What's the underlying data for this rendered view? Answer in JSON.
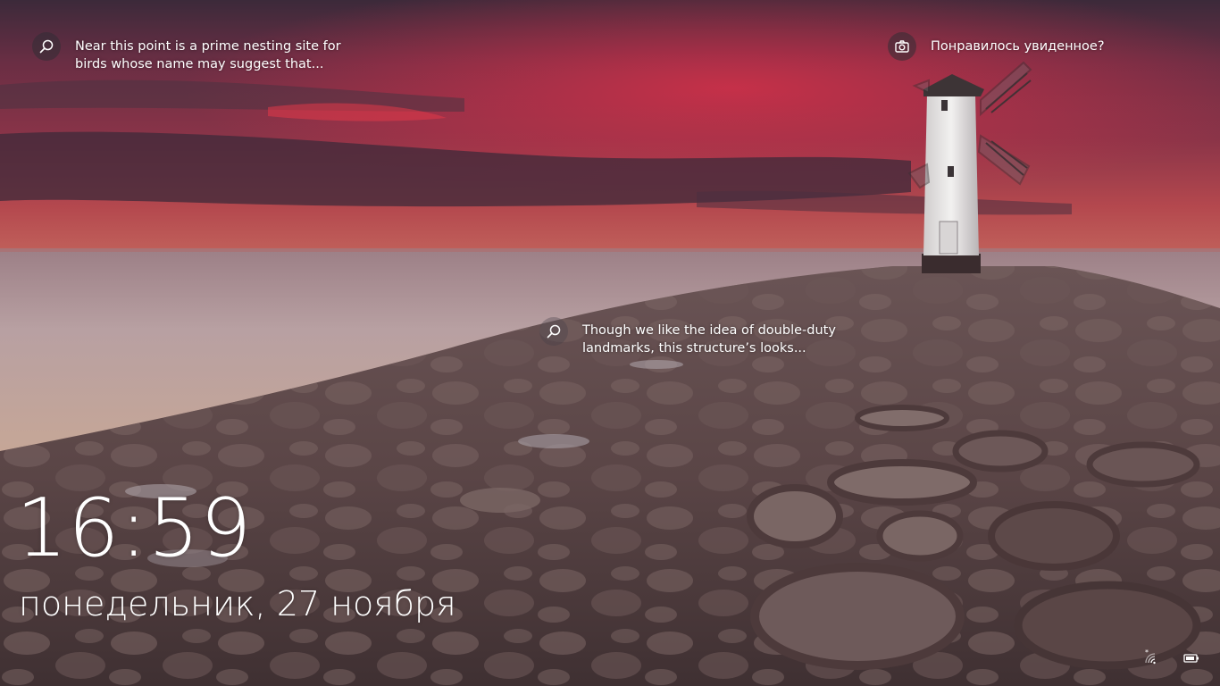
{
  "colors": {
    "sky_top": "#4a3040",
    "sky_red": "#c8344a",
    "horizon": "#a85a5c",
    "sea": "#b89a9a",
    "pier_stone": "#5e4a49",
    "tower_white": "#e9e8e7",
    "text": "#ffffff"
  },
  "hotspots": {
    "birds": {
      "icon": "search-icon",
      "text": "Near this point is a prime nesting site for\nbirds whose name may suggest that..."
    },
    "landmarks": {
      "icon": "search-icon",
      "text": "Though we like the idea of double-duty\nlandmarks, this structure’s looks..."
    },
    "like": {
      "icon": "camera-icon",
      "text": "Понравилось увиденное?"
    }
  },
  "lock": {
    "time": "16:59",
    "date": "понедельник, 27 ноября"
  },
  "tray": {
    "network_icon": "wifi-icon",
    "battery_icon": "battery-icon"
  }
}
